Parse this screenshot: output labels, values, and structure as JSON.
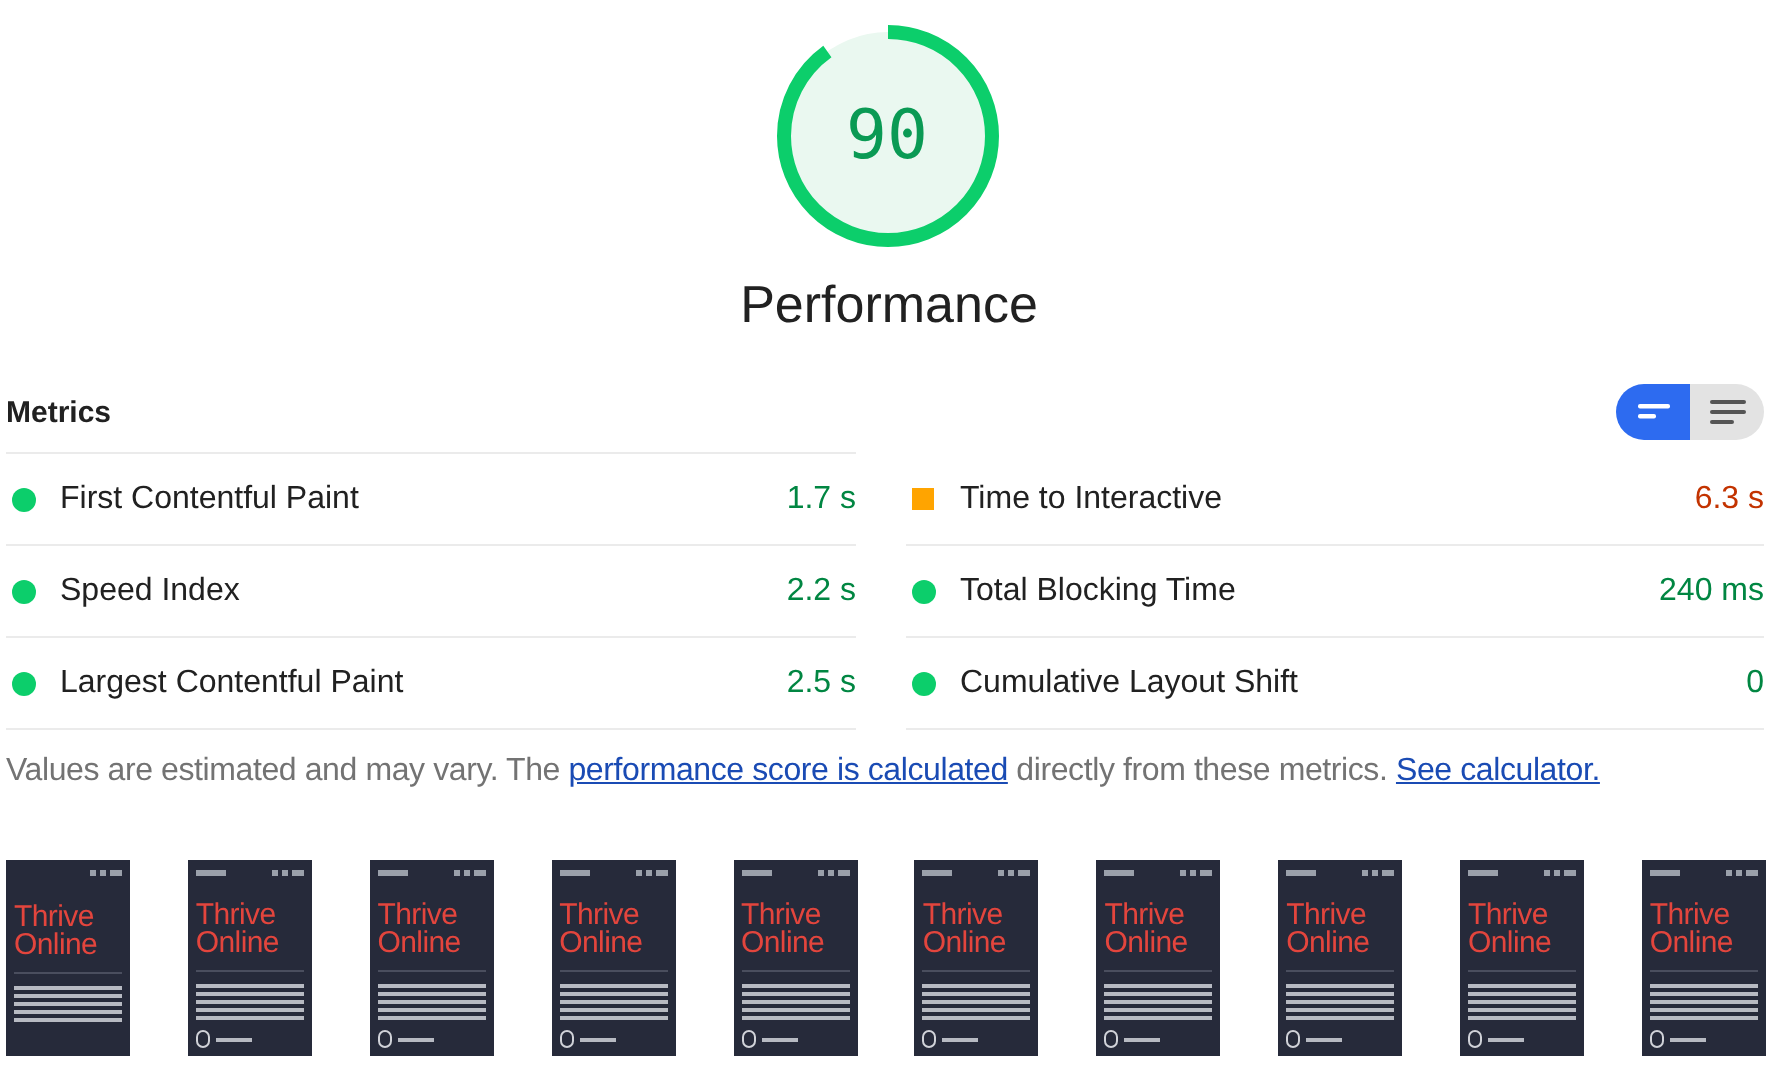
{
  "gauge": {
    "score": "90",
    "title": "Performance"
  },
  "metrics": {
    "title": "Metrics",
    "view_toggle": [
      {
        "kind": "summary",
        "selected": true
      },
      {
        "kind": "details",
        "selected": false
      }
    ],
    "items": [
      {
        "label": "First Contentful Paint",
        "value": "1.7 s",
        "color": "#0cce6b"
      },
      {
        "label": "Time to Interactive",
        "value": "6.3 s",
        "color": "#ffa400"
      },
      {
        "label": "Speed Index",
        "value": "2.2 s",
        "color": "#0cce6b"
      },
      {
        "label": "Total Blocking Time",
        "value": "240 ms",
        "color": "#0cce6b"
      },
      {
        "label": "Largest Contentful Paint",
        "value": "2.5 s",
        "color": "#0cce6b"
      },
      {
        "label": "Cumulative Layout Shift",
        "value": "0",
        "color": "#0cce6b"
      }
    ]
  },
  "note": {
    "text": "Values are estimated and may vary. The",
    "link1": "performance score is calculated",
    "middle": "directly from these metrics.",
    "link2": "See calculator."
  },
  "filmstrip": [
    {
      "headline": "Thrive Online",
      "loaded": false
    },
    {
      "headline": "Thrive Online",
      "loaded": true
    },
    {
      "headline": "Thrive Online",
      "loaded": true
    },
    {
      "headline": "Thrive Online",
      "loaded": true
    },
    {
      "headline": "Thrive Online",
      "loaded": true
    },
    {
      "headline": "Thrive Online",
      "loaded": true
    },
    {
      "headline": "Thrive Online",
      "loaded": true
    },
    {
      "headline": "Thrive Online",
      "loaded": true
    },
    {
      "headline": "Thrive Online",
      "loaded": true
    },
    {
      "headline": "Thrive Online",
      "loaded": true
    }
  ]
}
